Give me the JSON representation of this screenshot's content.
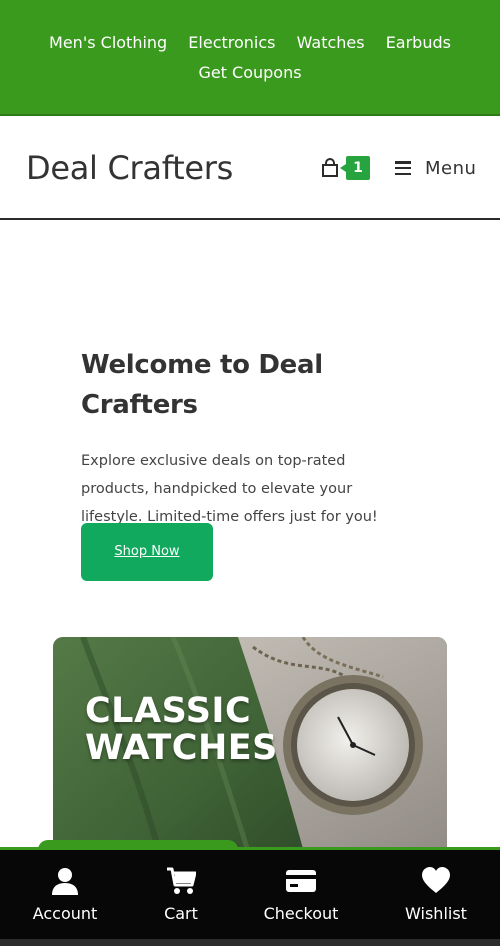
{
  "top_nav": {
    "items": [
      "Men's Clothing",
      "Electronics",
      "Watches",
      "Earbuds",
      "Get Coupons"
    ]
  },
  "header": {
    "site_title": "Deal Crafters",
    "cart_count": "1",
    "menu_label": "Menu"
  },
  "hero": {
    "title": "Welcome to Deal Crafters",
    "description": "Explore exclusive deals on top-rated products, handpicked to elevate your lifestyle. Limited-time offers just for you!",
    "button_label": "Shop Now"
  },
  "banner": {
    "line1": "CLASSIC",
    "line2": "WATCHES"
  },
  "bottom_bar": {
    "items": [
      {
        "label": "Account",
        "icon": "user-icon"
      },
      {
        "label": "Cart",
        "icon": "cart-icon"
      },
      {
        "label": "Checkout",
        "icon": "credit-card-icon"
      },
      {
        "label": "Wishlist",
        "icon": "heart-icon"
      }
    ]
  },
  "colors": {
    "brand_green": "#3a9a1e",
    "button_green": "#10a95e",
    "badge_green": "#27a33f",
    "bottom_bar": "#070707"
  }
}
